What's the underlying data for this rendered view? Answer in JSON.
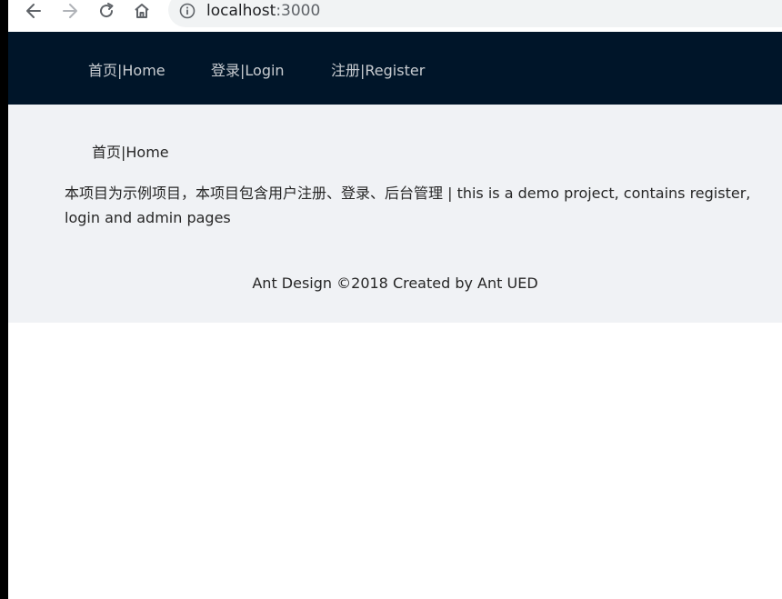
{
  "browser": {
    "url_host": "localhost",
    "url_port": ":3000"
  },
  "header": {
    "menu": [
      {
        "label": "首页|Home"
      },
      {
        "label": "登录|Login"
      },
      {
        "label": "注册|Register"
      }
    ]
  },
  "content": {
    "breadcrumb": "首页|Home",
    "description": "本项目为示例项目，本项目包含用户注册、登录、后台管理 | this is a demo project, contains register, login and admin pages"
  },
  "footer": {
    "text": "Ant Design ©2018 Created by Ant UED"
  },
  "colors": {
    "header_bg": "#001529",
    "content_bg": "#f0f2f5"
  },
  "icons": [
    "back-arrow-icon",
    "forward-arrow-icon",
    "reload-icon",
    "home-icon",
    "info-icon"
  ]
}
